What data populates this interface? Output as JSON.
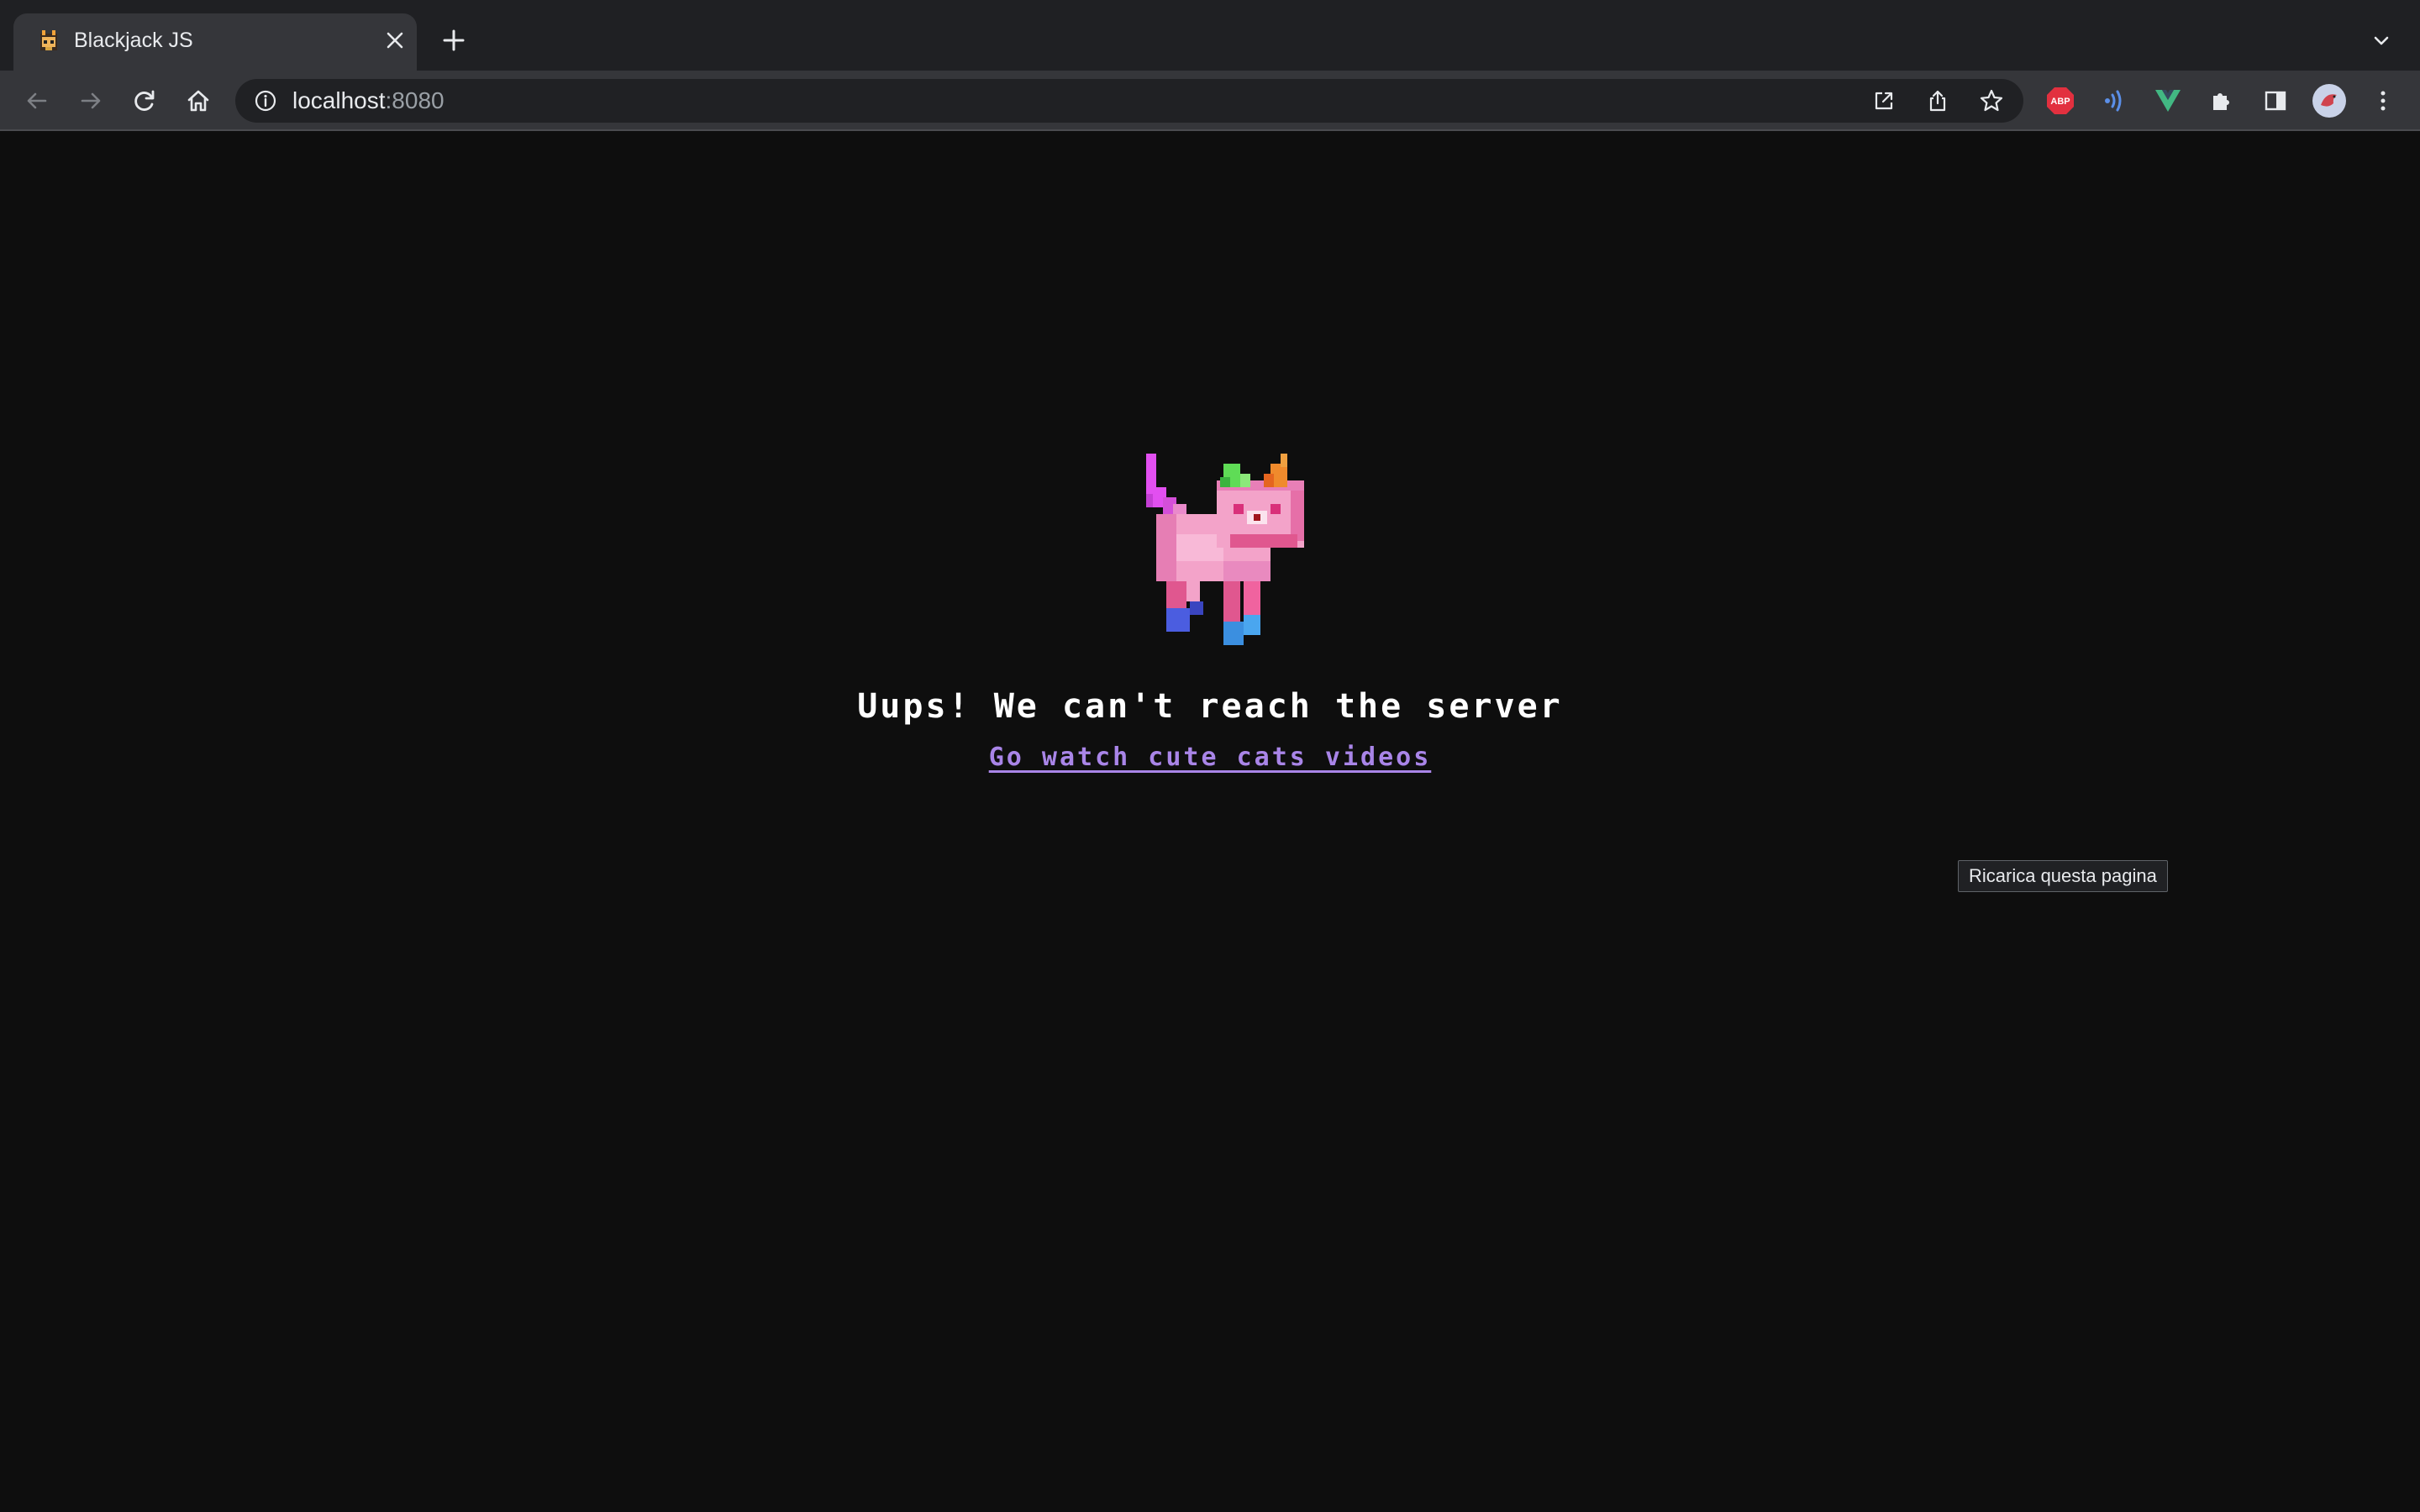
{
  "browser": {
    "tab": {
      "title": "Blackjack JS"
    },
    "address": {
      "host": "localhost",
      "port": ":8080"
    },
    "tooltip": "Ricarica questa pagina"
  },
  "extensions": {
    "abp_label": "ABP"
  },
  "page": {
    "error_message": "Uups! We can't reach the server",
    "link_text": "Go watch cute cats videos"
  },
  "colors": {
    "page_bg": "#0e0e0e",
    "link": "#a985e8",
    "cat_body": "#f3a3c9"
  }
}
